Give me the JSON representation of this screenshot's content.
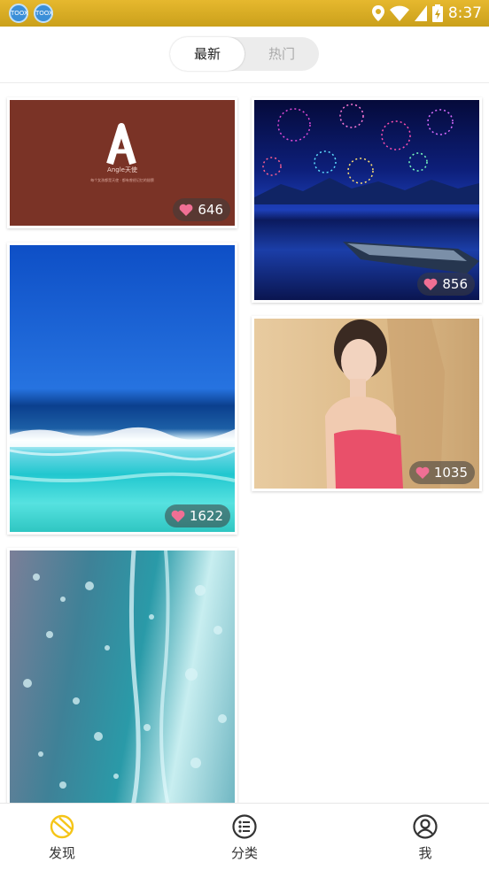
{
  "status_bar": {
    "time": "8:37",
    "app_icon_label": "TOOX"
  },
  "segment": {
    "tabs": [
      {
        "label": "最新"
      },
      {
        "label": "热门"
      }
    ],
    "selected_index": 0
  },
  "feed": {
    "cards": [
      {
        "likes": "646",
        "logo_text": "Angle天使",
        "logo_tagline": "每个女孩都是天使 · 都有曾经记忆的翅膀"
      },
      {
        "likes": "856"
      },
      {
        "likes": "1622"
      },
      {
        "likes": "1035"
      },
      {
        "likes": ""
      }
    ]
  },
  "tabbar": {
    "items": [
      {
        "label": "发现"
      },
      {
        "label": "分类"
      },
      {
        "label": "我"
      }
    ],
    "active_index": 0,
    "active_color": "#f5c518",
    "inactive_color": "#333333"
  },
  "colors": {
    "status_bar": "#dcae22",
    "like_heart": "#f06f94"
  }
}
